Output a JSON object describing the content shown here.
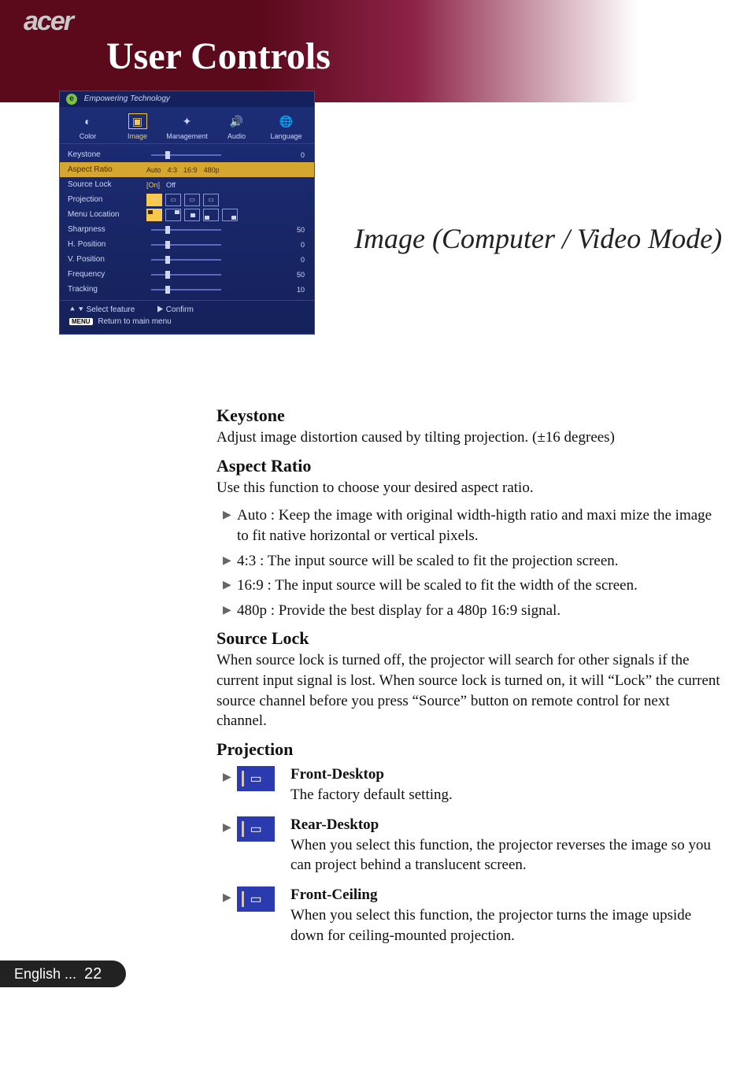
{
  "brand": "acer",
  "page_title": "User Controls",
  "osd": {
    "tagline": "Empowering Technology",
    "tabs": [
      "Color",
      "Image",
      "Management",
      "Audio",
      "Language"
    ],
    "selected_tab": "Image",
    "rows": {
      "keystone": {
        "label": "Keystone",
        "value": "0"
      },
      "aspect": {
        "label": "Aspect Ratio",
        "options": [
          "Auto",
          "4:3",
          "16:9",
          "480p"
        ]
      },
      "source": {
        "label": "Source Lock",
        "options": [
          "[On]",
          "Off"
        ]
      },
      "projection": {
        "label": "Projection"
      },
      "menuloc": {
        "label": "Menu Location"
      },
      "sharpness": {
        "label": "Sharpness",
        "value": "50"
      },
      "hpos": {
        "label": "H. Position",
        "value": "0"
      },
      "vpos": {
        "label": "V. Position",
        "value": "0"
      },
      "freq": {
        "label": "Frequency",
        "value": "50"
      },
      "tracking": {
        "label": "Tracking",
        "value": "10"
      }
    },
    "footer": {
      "select": "Select feature",
      "confirm": "Confirm",
      "menu_badge": "MENU",
      "return": "Return to main menu"
    }
  },
  "section_heading": "Image (Computer / Video Mode)",
  "sections": {
    "keystone": {
      "h": "Keystone",
      "p": "Adjust image distortion caused by tilting projection. (±16 degrees)"
    },
    "aspect": {
      "h": "Aspect Ratio",
      "p": "Use this function to choose your desired aspect ratio.",
      "items": [
        "Auto : Keep the image with original width-higth ratio and maxi mize the image to fit native horizontal or vertical pixels.",
        "4:3 : The input source will be scaled to fit the projection screen.",
        "16:9 : The input source will be scaled to fit the width of the screen.",
        "480p : Provide the best display for a 480p 16:9 signal."
      ]
    },
    "sourcelock": {
      "h": "Source Lock",
      "p": "When source lock is turned off, the projector will search for other signals if the current input signal is lost. When source lock is turned on, it will “Lock” the current source channel before you press “Source” button on remote control for next channel."
    },
    "projection": {
      "h": "Projection",
      "items": [
        {
          "t": "Front-Desktop",
          "d": "The factory default setting."
        },
        {
          "t": "Rear-Desktop",
          "d": "When you select this function, the projector reverses the image  so you can project behind a translucent screen."
        },
        {
          "t": "Front-Ceiling",
          "d": "When you select this function, the projector turns the image upside down for ceiling-mounted projection."
        }
      ]
    }
  },
  "footer": {
    "lang": "English ...",
    "page": "22"
  }
}
